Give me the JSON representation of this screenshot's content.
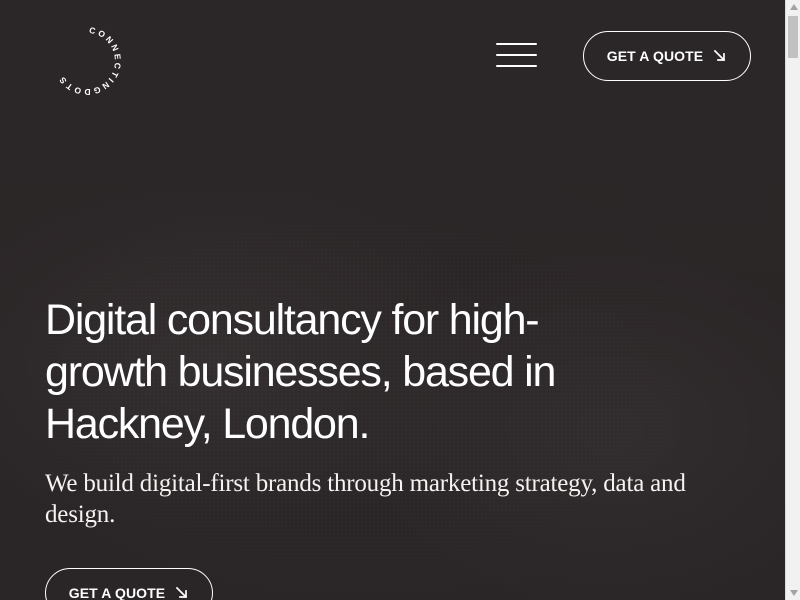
{
  "brand": {
    "logo_text": "CONNECTINGDOTS",
    "accent_color": "#2b2627"
  },
  "header": {
    "menu_icon": "hamburger-menu-icon",
    "quote_button": {
      "label": "GET A QUOTE",
      "icon": "arrow-down-right-icon"
    }
  },
  "hero": {
    "title": "Digital consultancy for high-growth businesses, based in Hackney, London.",
    "subtitle": "We build digital-first brands through marketing strategy, data and design.",
    "quote_button": {
      "label": "GET A QUOTE",
      "icon": "arrow-down-right-icon"
    }
  },
  "scrollbar": {
    "up_icon": "scroll-up-arrow-icon",
    "down_icon": "scroll-down-arrow-icon"
  }
}
